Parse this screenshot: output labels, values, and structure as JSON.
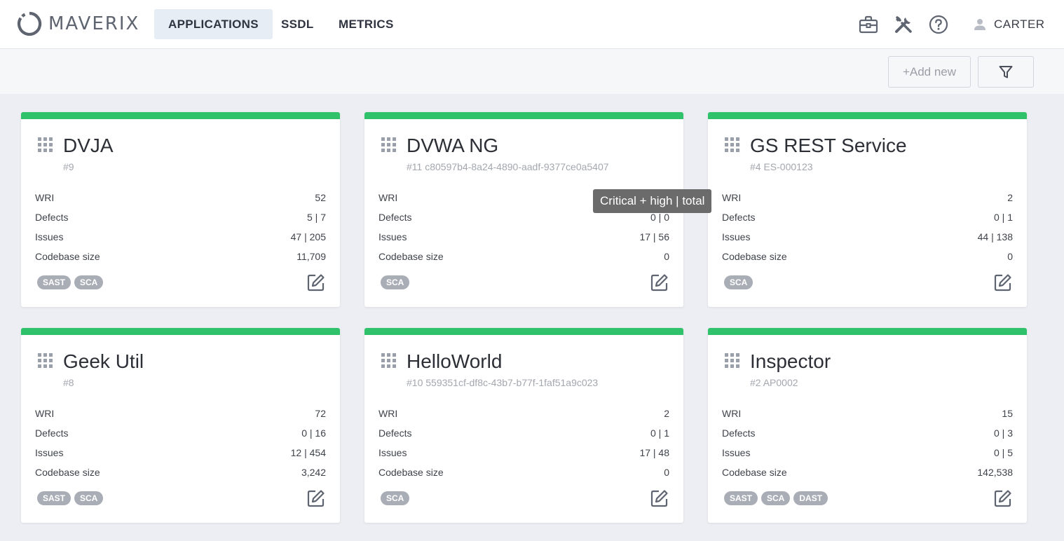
{
  "brand": {
    "name": "MAVERIX"
  },
  "nav": {
    "tabs": [
      {
        "label": "APPLICATIONS",
        "active": true
      },
      {
        "label": "SSDL",
        "active": false
      },
      {
        "label": "METRICS",
        "active": false
      }
    ]
  },
  "header_icons": [
    "briefcase-icon",
    "tools-icon",
    "help-icon"
  ],
  "user": {
    "name": "CARTER",
    "icon": "user-icon"
  },
  "toolbar": {
    "add_label": "+Add new",
    "filter_icon": "filter-icon"
  },
  "tooltip": {
    "text": "Critical + high | total"
  },
  "labels": {
    "wri": "WRI",
    "defects": "Defects",
    "issues": "Issues",
    "codebase": "Codebase size"
  },
  "colors": {
    "status_bar": "#2fc26a",
    "tag_bg": "#a9adb6",
    "tooltip_bg": "#6b6b6b"
  },
  "cards": [
    {
      "title": "DVJA",
      "subtitle": "#9",
      "wri": "52",
      "defects": "5 | 7",
      "issues": "47 | 205",
      "codebase": "11,709",
      "tags": [
        "SAST",
        "SCA"
      ]
    },
    {
      "title": "DVWA NG",
      "subtitle": "#11 c80597b4-8a24-4890-aadf-9377ce0a5407",
      "wri": "",
      "defects": "0 | 0",
      "issues": "17 | 56",
      "codebase": "0",
      "tags": [
        "SCA"
      ]
    },
    {
      "title": "GS REST Service",
      "subtitle": "#4 ES-000123",
      "wri": "2",
      "defects": "0 | 1",
      "issues": "44 | 138",
      "codebase": "0",
      "tags": [
        "SCA"
      ]
    },
    {
      "title": "Geek Util",
      "subtitle": "#8",
      "wri": "72",
      "defects": "0 | 16",
      "issues": "12 | 454",
      "codebase": "3,242",
      "tags": [
        "SAST",
        "SCA"
      ]
    },
    {
      "title": "HelloWorld",
      "subtitle": "#10 559351cf-df8c-43b7-b77f-1faf51a9c023",
      "wri": "2",
      "defects": "0 | 1",
      "issues": "17 | 48",
      "codebase": "0",
      "tags": [
        "SCA"
      ]
    },
    {
      "title": "Inspector",
      "subtitle": "#2 AP0002",
      "wri": "15",
      "defects": "0 | 3",
      "issues": "0 | 5",
      "codebase": "142,538",
      "tags": [
        "SAST",
        "SCA",
        "DAST"
      ]
    }
  ]
}
